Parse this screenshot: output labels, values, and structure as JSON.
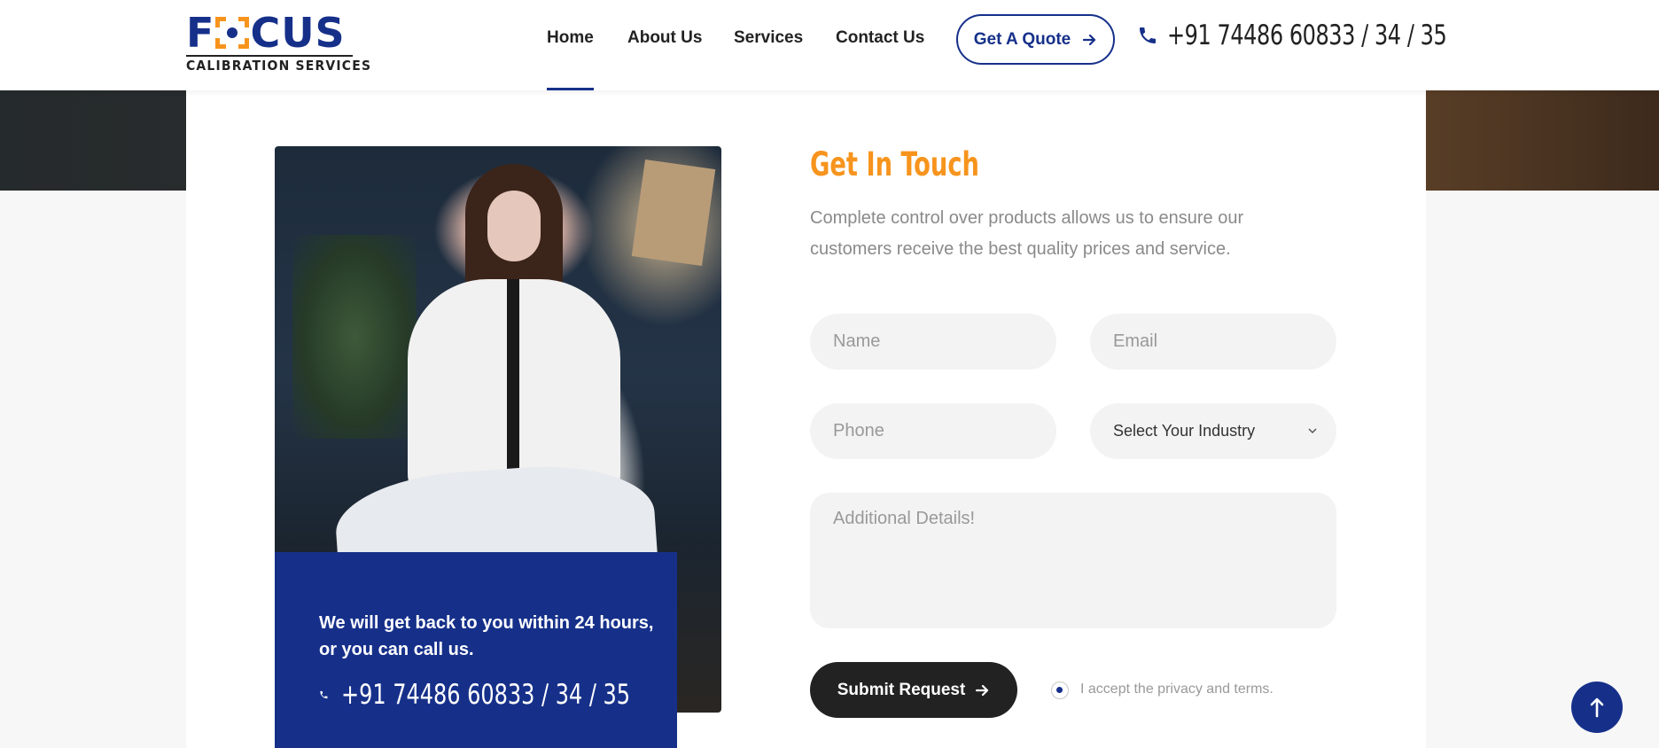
{
  "header": {
    "logo": {
      "word": "FOCUS",
      "sub": "CALIBRATION SERVICES"
    },
    "nav": [
      {
        "label": "Home",
        "active": true
      },
      {
        "label": "About Us"
      },
      {
        "label": "Services"
      },
      {
        "label": "Contact Us"
      }
    ],
    "quote_label": "Get A Quote",
    "phone": "+91 74486 60833 / 34 / 35",
    "icons": {
      "phone": "phone-icon",
      "quote_arrow": "arrow-right-icon"
    }
  },
  "contact_card": {
    "message": "We will get back to you within 24 hours, or you can call us.",
    "phone": "+91 74486 60833 / 34 / 35"
  },
  "form": {
    "title": "Get In Touch",
    "description": "Complete control over products allows us to ensure our customers receive the best quality prices and service.",
    "name_placeholder": "Name",
    "email_placeholder": "Email",
    "phone_placeholder": "Phone",
    "industry_selected": "Select Your Industry",
    "details_placeholder": "Additional Details!",
    "submit_label": "Submit Request",
    "terms_label": "I accept the privacy and terms."
  },
  "colors": {
    "brand_blue": "#16308a",
    "accent_orange": "#f7941d",
    "dark_button": "#222222"
  }
}
